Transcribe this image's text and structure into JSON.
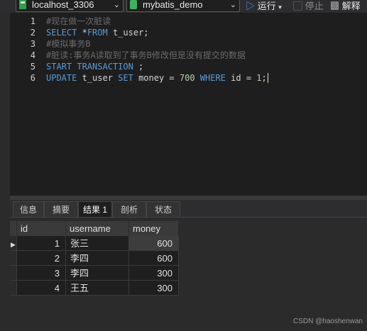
{
  "toolbar": {
    "connection": "localhost_3306",
    "database": "mybatis_demo",
    "run_label": "运行",
    "stop_label": "停止",
    "explain_label": "解释"
  },
  "editor": {
    "lines": [
      {
        "n": "1"
      },
      {
        "n": "2"
      },
      {
        "n": "3"
      },
      {
        "n": "4"
      },
      {
        "n": "5"
      },
      {
        "n": "6"
      }
    ],
    "code": {
      "l1": "#现在做一次脏读",
      "l2_kw": "SELECT",
      "l2_tx": " *",
      "l2_kw2": "FROM",
      "l2_tx2": " t_user;",
      "l3": "#模拟事务B",
      "l4": "#脏读:事务A读取到了事务B修改但是没有提交的数据",
      "l5_kw": "START TRANSACTION",
      "l5_tx": " ;",
      "l6_kw": "UPDATE",
      "l6_tx": " t_user ",
      "l6_kw2": "SET",
      "l6_tx2": " money = ",
      "l6_num": "700",
      "l6_kw3": " WHERE",
      "l6_tx3": " id = ",
      "l6_num2": "1",
      "l6_tx4": ";"
    }
  },
  "result_tabs": [
    "信息",
    "摘要",
    "结果 1",
    "剖析",
    "状态"
  ],
  "table": {
    "columns": [
      "id",
      "username",
      "money"
    ],
    "rows": [
      {
        "id": "1",
        "username": "张三",
        "money": "600"
      },
      {
        "id": "2",
        "username": "李四",
        "money": "600"
      },
      {
        "id": "3",
        "username": "李四",
        "money": "300"
      },
      {
        "id": "4",
        "username": "王五",
        "money": "300"
      }
    ]
  },
  "watermark": "CSDN @haoshenwan"
}
